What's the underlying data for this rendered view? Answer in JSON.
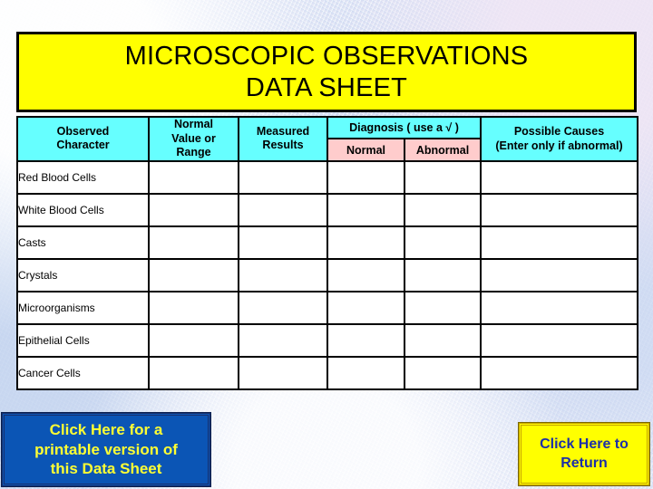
{
  "page": {
    "background_color": "#dbe4f4"
  },
  "title": {
    "text": "MICROSCOPIC OBSERVATIONS\nDATA SHEET",
    "background_color": "#ffff00",
    "text_color": "#000000"
  },
  "table": {
    "header_color": "#66ffff",
    "subheader_color": "#ffcccc",
    "cell_color": "#ffffff",
    "columns": [
      {
        "label": "Observed\nCharacter"
      },
      {
        "label": "Normal\nValue or\nRange"
      },
      {
        "label": "Measured\nResults"
      },
      {
        "label": "Diagnosis ( use a √ )"
      },
      {
        "label": "Possible Causes\n(Enter only if abnormal)"
      }
    ],
    "diagnosis_subcolumns": [
      {
        "label": "Normal"
      },
      {
        "label": "Abnormal"
      }
    ],
    "rows": [
      {
        "observed_character": "Red Blood Cells",
        "normal_value": "",
        "measured_results": "",
        "diagnosis_normal": "",
        "diagnosis_abnormal": "",
        "possible_causes": ""
      },
      {
        "observed_character": "White Blood Cells",
        "normal_value": "",
        "measured_results": "",
        "diagnosis_normal": "",
        "diagnosis_abnormal": "",
        "possible_causes": ""
      },
      {
        "observed_character": "Casts",
        "normal_value": "",
        "measured_results": "",
        "diagnosis_normal": "",
        "diagnosis_abnormal": "",
        "possible_causes": ""
      },
      {
        "observed_character": "Crystals",
        "normal_value": "",
        "measured_results": "",
        "diagnosis_normal": "",
        "diagnosis_abnormal": "",
        "possible_causes": ""
      },
      {
        "observed_character": "Microorganisms",
        "normal_value": "",
        "measured_results": "",
        "diagnosis_normal": "",
        "diagnosis_abnormal": "",
        "possible_causes": ""
      },
      {
        "observed_character": "Epithelial Cells",
        "normal_value": "",
        "measured_results": "",
        "diagnosis_normal": "",
        "diagnosis_abnormal": "",
        "possible_causes": ""
      },
      {
        "observed_character": "Cancer Cells",
        "normal_value": "",
        "measured_results": "",
        "diagnosis_normal": "",
        "diagnosis_abnormal": "",
        "possible_causes": ""
      }
    ]
  },
  "buttons": {
    "print": {
      "label": "Click Here for a\nprintable version of\nthis Data Sheet",
      "background_color": "#0b55b5",
      "text_color": "#ffff33"
    },
    "return": {
      "label": "Click Here to\nReturn",
      "background_color": "#ffff00",
      "text_color": "#1c2fa8"
    }
  }
}
